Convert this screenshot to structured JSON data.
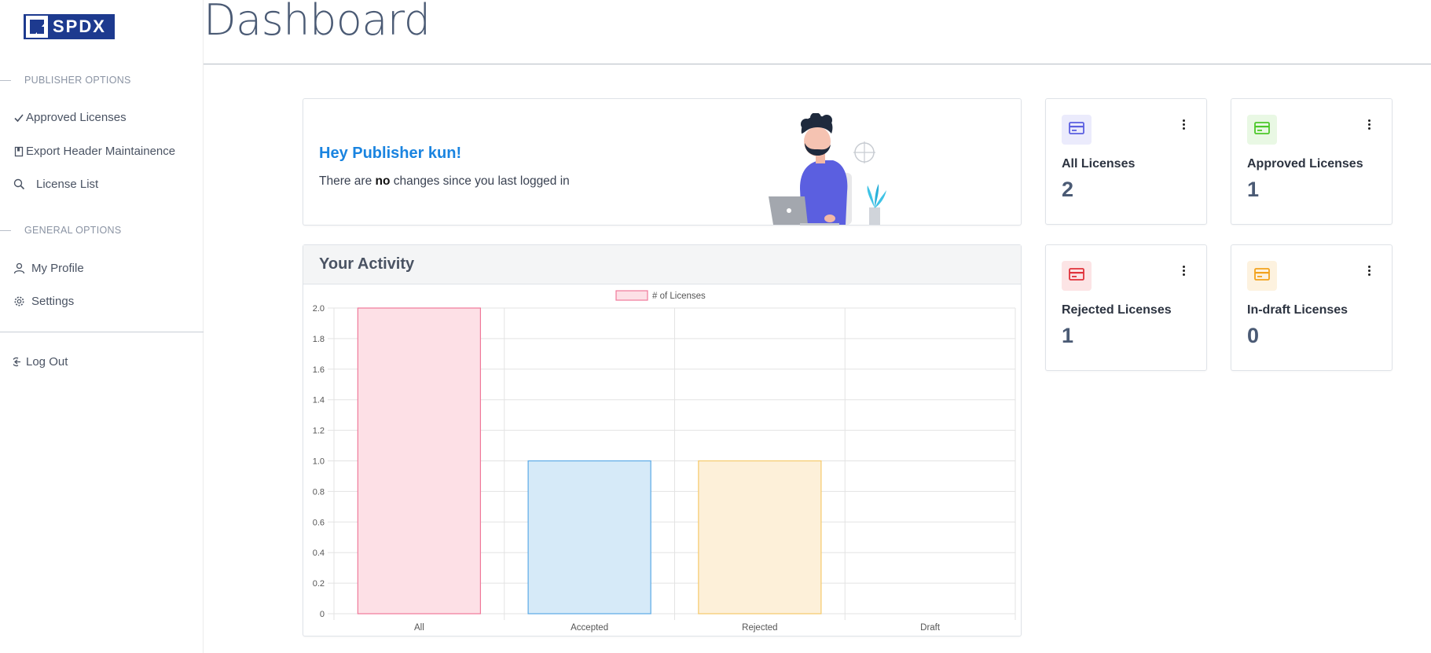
{
  "app": {
    "logo_text": "SPDX",
    "page_title": "Dashboard"
  },
  "sidebar": {
    "sections": [
      {
        "label": "PUBLISHER OPTIONS",
        "items": [
          {
            "label": "Approved Licenses",
            "icon": "check-icon"
          },
          {
            "label": "Export Header Maintainence",
            "icon": "book-icon"
          },
          {
            "label": "License List",
            "icon": "search-icon"
          }
        ]
      },
      {
        "label": "GENERAL OPTIONS",
        "items": [
          {
            "label": "My Profile",
            "icon": "user-icon"
          },
          {
            "label": "Settings",
            "icon": "gear-icon"
          }
        ]
      }
    ],
    "logout_label": "Log Out"
  },
  "welcome": {
    "title": "Hey Publisher kun!",
    "text_before": "There are ",
    "text_bold": "no",
    "text_after": " changes since you last logged in"
  },
  "activity": {
    "title": "Your Activity"
  },
  "stats": [
    {
      "label": "All Licenses",
      "value": "2",
      "color": "#5b5fe0",
      "bg": "#ebebfc",
      "icon": "card-icon"
    },
    {
      "label": "Approved Licenses",
      "value": "1",
      "color": "#4cc82a",
      "bg": "#e9f8e4",
      "icon": "card-icon"
    },
    {
      "label": "Rejected Licenses",
      "value": "1",
      "color": "#e0323b",
      "bg": "#fce4e5",
      "icon": "card-icon"
    },
    {
      "label": "In-draft Licenses",
      "value": "0",
      "color": "#f2a21c",
      "bg": "#fdf2df",
      "icon": "card-icon"
    }
  ],
  "chart_data": {
    "type": "bar",
    "categories": [
      "All",
      "Accepted",
      "Rejected",
      "Draft"
    ],
    "series": [
      {
        "name": "# of Licenses",
        "values": [
          2,
          1,
          1,
          0
        ],
        "fill_colors": [
          "#fde0e6",
          "#d6eaf8",
          "#fdf0d9",
          "#e9e9e9"
        ],
        "border_colors": [
          "#f0789a",
          "#5aa9e6",
          "#f5c96a",
          "#bbbbbb"
        ]
      }
    ],
    "ylim": [
      0,
      2
    ],
    "yticks": [
      "0",
      "0.2",
      "0.4",
      "0.6",
      "0.8",
      "1.0",
      "1.2",
      "1.4",
      "1.6",
      "1.8",
      "2.0"
    ],
    "legend": "top-center",
    "grid": true
  }
}
